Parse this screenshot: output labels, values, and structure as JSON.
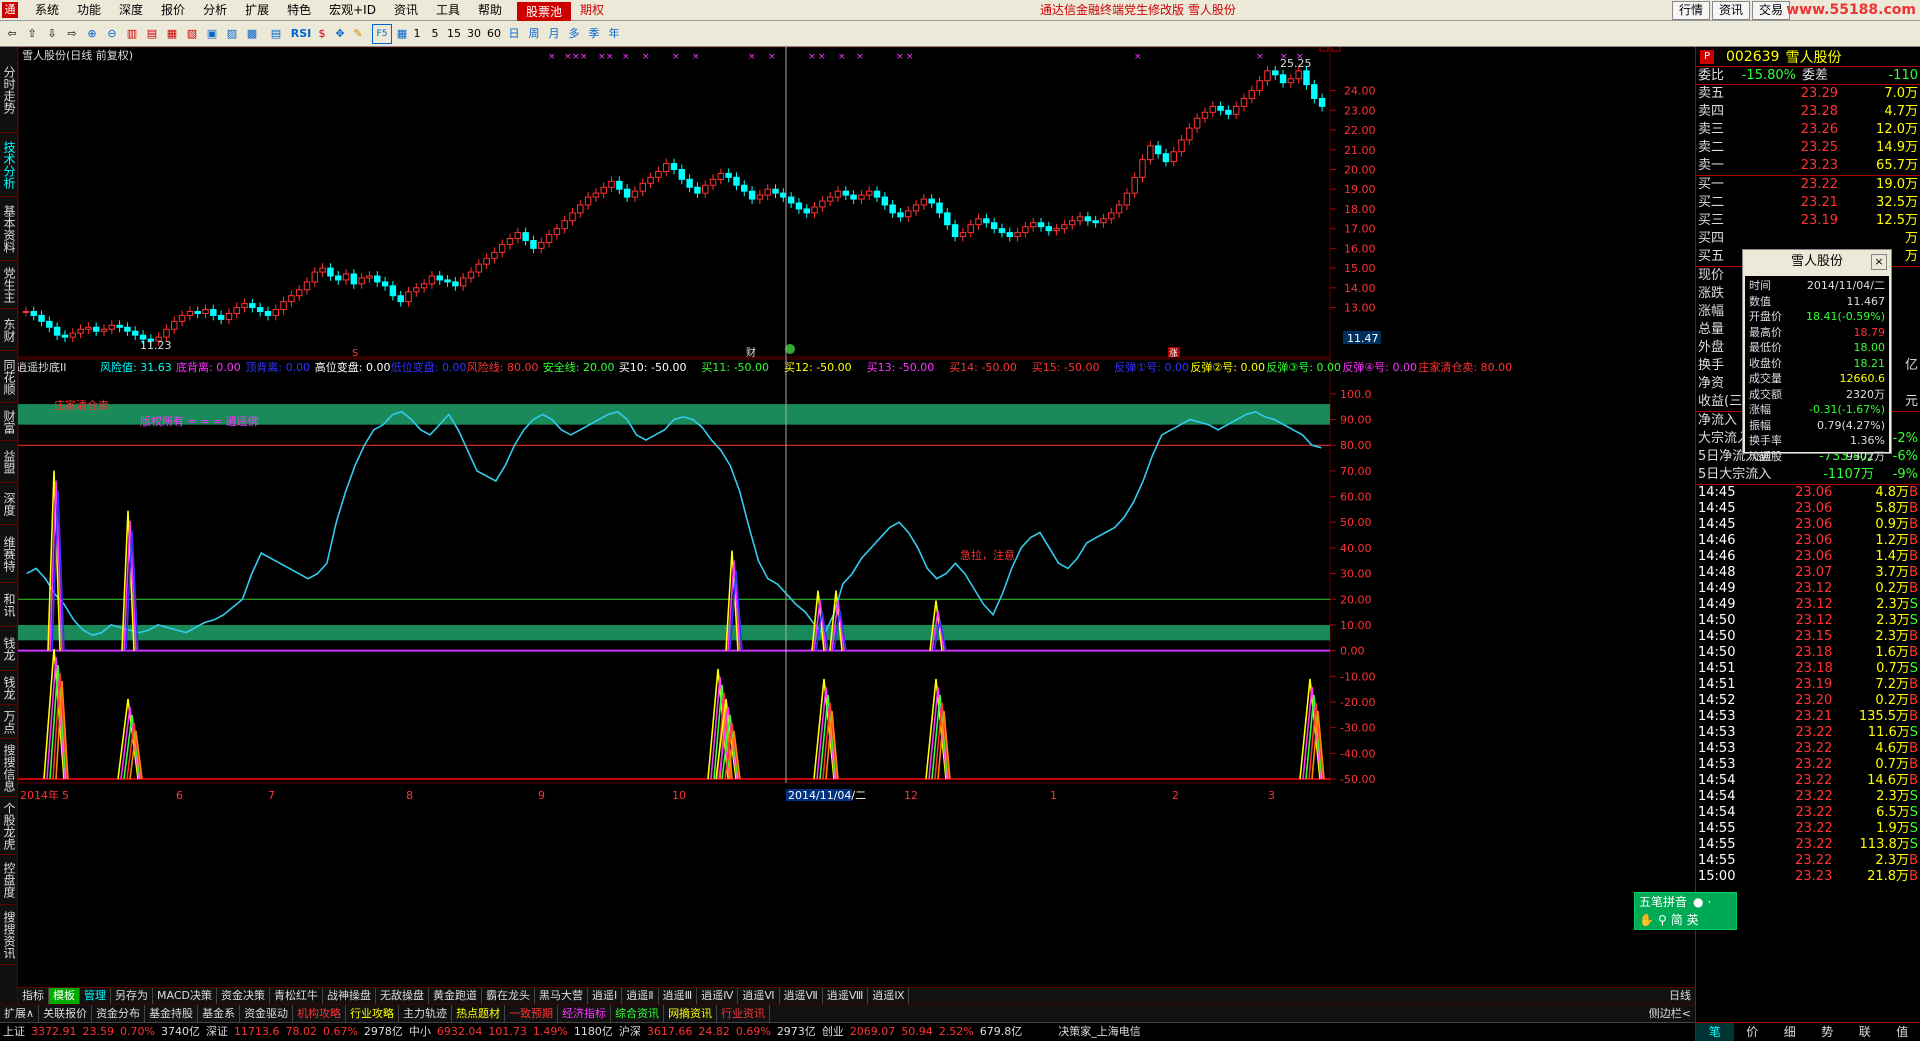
{
  "menubar": {
    "logo": "通",
    "menus": [
      "系统",
      "功能",
      "深度",
      "报价",
      "分析",
      "扩展",
      "特色",
      "宏观+ID",
      "资讯",
      "工具",
      "帮助"
    ],
    "pool_btn": "股票池",
    "futures_btn": "期权",
    "title": "通达信金融终端党生修改版   雪人股份",
    "right_buttons": [
      "行情",
      "资讯",
      "交易"
    ],
    "watermark": "www.55188.com"
  },
  "toolbar": {
    "periods": [
      "1",
      "5",
      "15",
      "30",
      "60",
      "日",
      "周",
      "月",
      "多",
      "季",
      "年"
    ],
    "rsi": "RSI",
    "f5": "F5"
  },
  "left_tabs": [
    "分时走势",
    "技术分析",
    "基本资料",
    "党生主页",
    "东财10",
    "同花顺10",
    "财富10",
    "益盟10",
    "深度F9",
    "维赛特10",
    "和讯10",
    "钱龙10",
    "钱龙",
    "万点",
    "搜搜信息",
    "个股龙虎",
    "控盘度",
    "搜搜资讯"
  ],
  "main_chart": {
    "header": "雪人股份(日线 前复权)",
    "high_label": "25.25",
    "low_label": "11.23",
    "price_ticks": [
      "24.00",
      "23.00",
      "22.00",
      "21.00",
      "20.00",
      "19.00",
      "18.00",
      "17.00",
      "16.00",
      "15.00",
      "14.00",
      "13.00"
    ],
    "current_price_tag": "11.47",
    "markers": {
      "s": "S",
      "cai": "财",
      "zhang": "涨"
    }
  },
  "indicator": {
    "name": "逍遥抄底II",
    "legend": [
      {
        "label": "风险值: 31.63",
        "color": "#00ffff"
      },
      {
        "label": "底背离: 0.00",
        "color": "#ff33ff"
      },
      {
        "label": "顶背离: 0.00",
        "color": "#3333ff"
      },
      {
        "label": "高位变盘: 0.00",
        "color": "#ffffff"
      },
      {
        "label": "低位变盘: 0.00",
        "color": "#3333ff"
      },
      {
        "label": "风险线: 80.00",
        "color": "#ff3333"
      },
      {
        "label": "安全线: 20.00",
        "color": "#33ff33"
      },
      {
        "label": "买10: -50.00",
        "color": "#ffffff"
      },
      {
        "label": "买11: -50.00",
        "color": "#33ff33"
      },
      {
        "label": "买12: -50.00",
        "color": "#ffff00"
      },
      {
        "label": "买13: -50.00",
        "color": "#ff33ff"
      },
      {
        "label": "买14: -50.00",
        "color": "#ff3333"
      },
      {
        "label": "买15: -50.00",
        "color": "#ff3333"
      },
      {
        "label": "反弹①号: 0.00",
        "color": "#3333ff"
      },
      {
        "label": "反弹②号: 0.00",
        "color": "#ffff00"
      },
      {
        "label": "反弹③号: 0.00",
        "color": "#33ff33"
      },
      {
        "label": "反弹④号: 0.00",
        "color": "#ff33ff"
      },
      {
        "label": "庄家清仓卖: 80.00",
        "color": "#ff3333"
      }
    ],
    "note_sell": "庄家清仓卖",
    "copyright": "版权所有 = = = 逍遥佛",
    "note_rush": "急拉，注意",
    "ticks": [
      "100.0",
      "90.00",
      "80.00",
      "70.00",
      "60.00",
      "50.00",
      "40.00",
      "30.00",
      "20.00",
      "10.00",
      "0.00",
      "-10.00",
      "-20.00",
      "-30.00",
      "-40.00",
      "-50.00"
    ]
  },
  "x_axis": [
    "2014年",
    "5",
    "6",
    "7",
    "8",
    "9",
    "10",
    "2014/11/04/二",
    "12",
    "1",
    "2",
    "3"
  ],
  "period_label": "日线",
  "bottom_tabs": [
    "指标",
    "模板",
    "管理",
    "另存为",
    "MACD决策",
    "资金决策",
    "青松红牛",
    "战神操盘",
    "无敌操盘",
    "黄金跑道",
    "霸在龙头",
    "黑马大营",
    "逍遥Ⅰ",
    "逍遥Ⅱ",
    "逍遥Ⅲ",
    "逍遥Ⅳ",
    "逍遥Ⅵ",
    "逍遥Ⅶ",
    "逍遥Ⅷ",
    "逍遥Ⅸ"
  ],
  "bottom_tabs2": [
    {
      "t": "扩展∧",
      "c": "#ddd"
    },
    {
      "t": "关联报价",
      "c": "#ddd"
    },
    {
      "t": "资金分布",
      "c": "#ddd"
    },
    {
      "t": "基金持股",
      "c": "#ddd"
    },
    {
      "t": "基金系",
      "c": "#ddd"
    },
    {
      "t": "资金驱动",
      "c": "#ddd"
    },
    {
      "t": "机构攻略",
      "c": "#ff3333"
    },
    {
      "t": "行业攻略",
      "c": "#ffff00"
    },
    {
      "t": "主力轨迹",
      "c": "#ddd"
    },
    {
      "t": "热点题材",
      "c": "#ffff00"
    },
    {
      "t": "一致预期",
      "c": "#ff3333"
    },
    {
      "t": "经济指标",
      "c": "#ff33ff"
    },
    {
      "t": "综合资讯",
      "c": "#33ff33"
    },
    {
      "t": "网摘资讯",
      "c": "#ffff00"
    },
    {
      "t": "行业资讯",
      "c": "#ff3333"
    }
  ],
  "sidebar_footer_label": "侧边栏<",
  "sidebar_tabs": [
    "笔",
    "价",
    "细",
    "势",
    "联",
    "值"
  ],
  "statusbar": [
    {
      "t": "上证",
      "c": "#ddd"
    },
    {
      "t": "3372.91",
      "c": "#ff3333"
    },
    {
      "t": "23.59",
      "c": "#ff3333"
    },
    {
      "t": "0.70%",
      "c": "#ff3333"
    },
    {
      "t": "3740亿",
      "c": "#ddd"
    },
    {
      "t": "深证",
      "c": "#ddd"
    },
    {
      "t": "11713.6",
      "c": "#ff3333"
    },
    {
      "t": "78.02",
      "c": "#ff3333"
    },
    {
      "t": "0.67%",
      "c": "#ff3333"
    },
    {
      "t": "2978亿",
      "c": "#ddd"
    },
    {
      "t": "中小",
      "c": "#ddd"
    },
    {
      "t": "6932.04",
      "c": "#ff3333"
    },
    {
      "t": "101.73",
      "c": "#ff3333"
    },
    {
      "t": "1.49%",
      "c": "#ff3333"
    },
    {
      "t": "1180亿",
      "c": "#ddd"
    },
    {
      "t": "沪深",
      "c": "#ddd"
    },
    {
      "t": "3617.66",
      "c": "#ff3333"
    },
    {
      "t": "24.82",
      "c": "#ff3333"
    },
    {
      "t": "0.69%",
      "c": "#ff3333"
    },
    {
      "t": "2973亿",
      "c": "#ddd"
    },
    {
      "t": "创业",
      "c": "#ddd"
    },
    {
      "t": "2069.07",
      "c": "#ff3333"
    },
    {
      "t": "50.94",
      "c": "#ff3333"
    },
    {
      "t": "2.52%",
      "c": "#ff3333"
    },
    {
      "t": "679.8亿",
      "c": "#ddd"
    },
    {
      "t": "决策家_上海电信",
      "c": "#ddd"
    }
  ],
  "quote": {
    "code": "002639",
    "name": "雪人股份",
    "weibi_label": "委比",
    "weibi": "-15.80%",
    "weicha_label": "委差",
    "weicha": "-110",
    "asks": [
      {
        "l": "卖五",
        "p": "23.29",
        "v": "7.0万"
      },
      {
        "l": "卖四",
        "p": "23.28",
        "v": "4.7万"
      },
      {
        "l": "卖三",
        "p": "23.26",
        "v": "12.0万"
      },
      {
        "l": "卖二",
        "p": "23.25",
        "v": "14.9万"
      },
      {
        "l": "卖一",
        "p": "23.23",
        "v": "65.7万"
      }
    ],
    "bids": [
      {
        "l": "买一",
        "p": "23.22",
        "v": "19.0万"
      },
      {
        "l": "买二",
        "p": "23.21",
        "v": "32.5万"
      },
      {
        "l": "买三",
        "p": "23.19",
        "v": "12.5万"
      },
      {
        "l": "买四",
        "p": "",
        "v": "万"
      },
      {
        "l": "买五",
        "p": "",
        "v": "万"
      }
    ],
    "info_labels": [
      "现价",
      "涨跌",
      "涨幅",
      "总量",
      "外盘",
      "换手",
      "净资",
      "收益(三)"
    ],
    "info_right": [
      "",
      "",
      "",
      "",
      "",
      "亿",
      "",
      "元"
    ],
    "flow": [
      {
        "l": "净流入",
        "v": "",
        "p": "",
        "c": "#ddd"
      },
      {
        "l": "大宗流入",
        "v": "-36.4万",
        "p": "-2%",
        "c": "#33ff33"
      },
      {
        "l": "5日净流入额",
        "v": "-733.4万",
        "p": "-6%",
        "c": "#33ff33"
      },
      {
        "l": "5日大宗流入",
        "v": "-1107万",
        "p": "-9%",
        "c": "#33ff33"
      }
    ],
    "ticks": [
      {
        "t": "14:45",
        "p": "23.06",
        "v": "4.8万",
        "s": "B"
      },
      {
        "t": "14:45",
        "p": "23.06",
        "v": "5.8万",
        "s": "B"
      },
      {
        "t": "14:45",
        "p": "23.06",
        "v": "0.9万",
        "s": "B"
      },
      {
        "t": "14:46",
        "p": "23.06",
        "v": "1.2万",
        "s": "B"
      },
      {
        "t": "14:46",
        "p": "23.06",
        "v": "1.4万",
        "s": "B"
      },
      {
        "t": "14:48",
        "p": "23.07",
        "v": "3.7万",
        "s": "B"
      },
      {
        "t": "14:49",
        "p": "23.12",
        "v": "0.2万",
        "s": "B"
      },
      {
        "t": "14:49",
        "p": "23.12",
        "v": "2.3万",
        "s": "S"
      },
      {
        "t": "14:50",
        "p": "23.12",
        "v": "2.3万",
        "s": "S"
      },
      {
        "t": "14:50",
        "p": "23.15",
        "v": "2.3万",
        "s": "B"
      },
      {
        "t": "14:50",
        "p": "23.18",
        "v": "1.6万",
        "s": "B"
      },
      {
        "t": "14:51",
        "p": "23.18",
        "v": "0.7万",
        "s": "S"
      },
      {
        "t": "14:51",
        "p": "23.19",
        "v": "7.2万",
        "s": "B"
      },
      {
        "t": "14:52",
        "p": "23.20",
        "v": "0.2万",
        "s": "B"
      },
      {
        "t": "14:53",
        "p": "23.21",
        "v": "135.5万",
        "s": "B"
      },
      {
        "t": "14:53",
        "p": "23.22",
        "v": "11.6万",
        "s": "S"
      },
      {
        "t": "14:53",
        "p": "23.22",
        "v": "4.6万",
        "s": "B"
      },
      {
        "t": "14:53",
        "p": "23.22",
        "v": "0.7万",
        "s": "B"
      },
      {
        "t": "14:54",
        "p": "23.22",
        "v": "14.6万",
        "s": "B"
      },
      {
        "t": "14:54",
        "p": "23.22",
        "v": "2.3万",
        "s": "S"
      },
      {
        "t": "14:54",
        "p": "23.22",
        "v": "6.5万",
        "s": "S"
      },
      {
        "t": "14:55",
        "p": "23.22",
        "v": "1.9万",
        "s": "S"
      },
      {
        "t": "14:55",
        "p": "23.22",
        "v": "113.8万",
        "s": "S"
      },
      {
        "t": "14:55",
        "p": "23.22",
        "v": "2.3万",
        "s": "B"
      },
      {
        "t": "15:00",
        "p": "23.23",
        "v": "21.8万",
        "s": "B"
      }
    ]
  },
  "popup": {
    "title": "雪人股份",
    "rows": [
      {
        "l": "时间",
        "v": "2014/11/04/二",
        "c": "#ddd"
      },
      {
        "l": "数值",
        "v": "11.467",
        "c": "#ddd"
      },
      {
        "l": "开盘价",
        "v": "18.41(-0.59%)",
        "c": "#33ff33"
      },
      {
        "l": "最高价",
        "v": "18.79",
        "c": "#ff3333"
      },
      {
        "l": "最低价",
        "v": "18.00",
        "c": "#33ff33"
      },
      {
        "l": "收盘价",
        "v": "18.21",
        "c": "#33ff33"
      },
      {
        "l": "成交量",
        "v": "12660.6",
        "c": "#ffff00"
      },
      {
        "l": "成交额",
        "v": "2320万",
        "c": "#ddd"
      },
      {
        "l": "涨幅",
        "v": "-0.31(-1.67%)",
        "c": "#33ff33"
      },
      {
        "l": "振幅",
        "v": "0.79(4.27%)",
        "c": "#ddd"
      },
      {
        "l": "换手率",
        "v": "1.36%",
        "c": "#ddd"
      },
      {
        "l": "流通股",
        "v": "9302万",
        "c": "#ddd"
      }
    ]
  },
  "wubi": {
    "title": "五笔拼音",
    "line2": "简 英"
  },
  "chart_data": {
    "type": "candlestick",
    "title": "雪人股份(日线 前复权)",
    "x_range": [
      "2014年",
      "3"
    ],
    "ylim": [
      11.0,
      25.5
    ],
    "high": 25.25,
    "low": 11.23,
    "closes": [
      12.8,
      12.6,
      12.3,
      12.0,
      11.6,
      11.5,
      11.7,
      11.9,
      12.0,
      11.8,
      11.9,
      12.1,
      12.0,
      11.8,
      11.6,
      11.4,
      11.3,
      11.5,
      11.9,
      12.3,
      12.6,
      12.8,
      12.7,
      12.9,
      12.6,
      12.4,
      12.7,
      13.0,
      13.2,
      13.0,
      12.8,
      12.6,
      12.9,
      13.3,
      13.6,
      13.9,
      14.3,
      14.8,
      15.0,
      14.6,
      14.4,
      14.7,
      14.2,
      14.5,
      14.6,
      14.3,
      14.1,
      13.6,
      13.3,
      13.8,
      14.0,
      14.2,
      14.6,
      14.4,
      14.3,
      14.1,
      14.5,
      14.8,
      15.2,
      15.5,
      15.8,
      16.2,
      16.5,
      16.8,
      16.4,
      16.0,
      16.3,
      16.7,
      17.0,
      17.4,
      17.8,
      18.2,
      18.6,
      18.8,
      19.1,
      19.4,
      19.0,
      18.6,
      18.9,
      19.3,
      19.6,
      19.9,
      20.3,
      20.0,
      19.5,
      19.1,
      18.8,
      19.2,
      19.5,
      19.8,
      19.6,
      19.2,
      18.9,
      18.5,
      18.7,
      19.0,
      18.8,
      18.6,
      18.3,
      18.0,
      17.8,
      18.1,
      18.4,
      18.6,
      18.9,
      18.7,
      18.5,
      18.7,
      18.9,
      18.6,
      18.2,
      17.8,
      17.6,
      17.9,
      18.2,
      18.5,
      18.3,
      17.8,
      17.2,
      16.6,
      16.8,
      17.2,
      17.5,
      17.3,
      17.0,
      16.8,
      16.6,
      16.8,
      17.1,
      17.3,
      17.1,
      16.9,
      17.0,
      17.2,
      17.4,
      17.6,
      17.4,
      17.3,
      17.5,
      17.8,
      18.2,
      18.8,
      19.6,
      20.5,
      21.2,
      20.8,
      20.4,
      20.9,
      21.5,
      22.1,
      22.6,
      22.9,
      23.2,
      23.0,
      22.8,
      23.2,
      23.6,
      24.0,
      24.5,
      25.0,
      24.8,
      24.4,
      24.6,
      25.0,
      24.3,
      23.6,
      23.2
    ],
    "indicator": {
      "name": "逍遥抄底II",
      "risk_line": 80,
      "safe_line": 20,
      "risk_value": 31.63,
      "ylim": [
        -50,
        105
      ],
      "values": [
        30,
        32,
        28,
        22,
        18,
        12,
        8,
        6,
        7,
        10,
        9,
        8,
        7,
        8,
        10,
        9,
        8,
        7,
        9,
        11,
        12,
        14,
        17,
        20,
        30,
        38,
        36,
        34,
        32,
        30,
        28,
        30,
        34,
        50,
        62,
        72,
        80,
        86,
        88,
        92,
        93,
        90,
        86,
        84,
        88,
        92,
        86,
        78,
        70,
        68,
        66,
        72,
        80,
        86,
        90,
        92,
        90,
        86,
        84,
        86,
        88,
        90,
        92,
        93,
        90,
        84,
        82,
        84,
        86,
        90,
        91,
        90,
        87,
        82,
        78,
        72,
        62,
        48,
        35,
        28,
        26,
        22,
        18,
        15,
        10,
        6,
        14,
        26,
        30,
        36,
        40,
        44,
        48,
        50,
        46,
        40,
        32,
        28,
        30,
        34,
        30,
        24,
        18,
        14,
        22,
        32,
        40,
        44,
        46,
        40,
        34,
        32,
        36,
        42,
        44,
        46,
        48,
        52,
        58,
        66,
        76,
        84,
        86,
        88,
        90,
        89,
        88,
        86,
        88,
        90,
        92,
        93,
        91,
        90,
        88,
        86,
        84,
        80,
        79
      ],
      "legend": [
        "风险值: 31.63",
        "底背离: 0.00",
        "顶背离: 0.00",
        "高位变盘: 0.00",
        "低位变盘: 0.00",
        "风险线: 80.00",
        "安全线: 20.00",
        "买10: -50.00",
        "买11: -50.00",
        "买12: -50.00",
        "买13: -50.00",
        "买14: -50.00",
        "买15: -50.00",
        "反弹①号: 0.00",
        "反弹②号: 0.00",
        "反弹③号: 0.00",
        "反弹④号: 0.00",
        "庄家清仓卖: 80.00"
      ]
    }
  }
}
